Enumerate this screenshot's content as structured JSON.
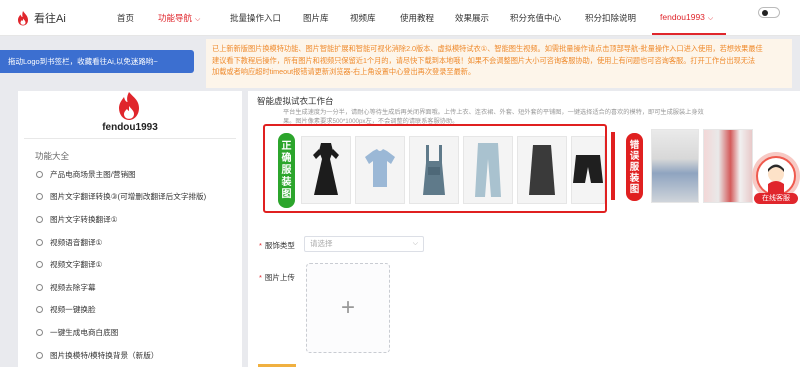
{
  "app": {
    "name": "看往Ai",
    "brand_color": "#e0262c"
  },
  "nav": {
    "items": [
      "首页",
      "功能导航",
      "批量操作入口",
      "图片库",
      "视频库",
      "使用教程",
      "效果展示",
      "积分充值中心",
      "积分扣除说明"
    ],
    "active": "功能导航",
    "user": "fendou1993"
  },
  "bookmark_banner": "拖动Logo到书签栏，收藏看往Ai,以免迷路哟~",
  "notice": {
    "lines": [
      "已上新新版图片换模特功能、图片智能扩展和智能可视化消除2.0版本、虚拟模特试衣①、智能图生视频。如需批量操作请点击顶部导航-批量操作入口进入使用，若想效果最佳",
      "建议看下教程后操作，所有图片和视频只保留近1个月的，请尽快下载到本地哦！如果不会调整图片大小可咨询客服协助，使用上有问题也可咨询客服。打开工作台出现无法",
      "加载或者响应超时timeout报错请更新浏览器-右上角设置中心登出再次登录至最新。"
    ]
  },
  "sidebar": {
    "username": "fendou1993",
    "section_title": "功能大全",
    "items": [
      "产品电商场景主图/营销图",
      "图片文字翻译转换③(可增删改翻译后文字排版)",
      "图片文字转换翻译①",
      "视频语音翻译①",
      "视频文字翻译①",
      "视频去除字幕",
      "视频一键换脸",
      "一键生成电商白底图",
      "图片换模特/模特换背景（新版）"
    ]
  },
  "main": {
    "title": "智能虚拟试衣工作台",
    "desc": [
      "平台生成速度为一分半，请耐心等待生成后再关闭界面哦。上传上衣、连衣裙、外套、短外套的平铺图，一键选择适合的喜欢的模特，即可生成服装上身效",
      "果。图片像素要求500*1000px左，不会调整的请联系客服协助。"
    ],
    "correct_tag": [
      "正",
      "确",
      "服",
      "装",
      "图"
    ],
    "wrong_tag": [
      "错",
      "误",
      "服",
      "装",
      "图"
    ],
    "correct_items": [
      "dress-black",
      "tshirt-blue",
      "overalls-denim",
      "jeans-wide",
      "skirt-black",
      "shorts-black"
    ],
    "clothing_type_label": "服饰类型",
    "clothing_type_placeholder": "请选择",
    "upload_label": "图片上传"
  },
  "service": {
    "label": "在线客服"
  }
}
